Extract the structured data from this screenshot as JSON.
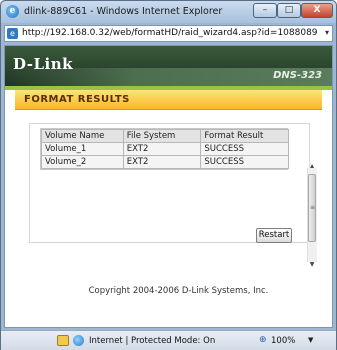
{
  "window": {
    "title": "dlink-889C61 - Windows Internet Explorer",
    "minimize_label": "–",
    "maximize_label": "□",
    "close_label": "X"
  },
  "address": {
    "url": "http://192.168.0.32/web/formatHD/raid_wizard4.asp?id=1088089"
  },
  "header": {
    "brand": "D-Link",
    "model": "DNS-323"
  },
  "section": {
    "title": "FORMAT RESULTS"
  },
  "results": {
    "columns": [
      "Volume Name",
      "File System",
      "Format Result"
    ],
    "rows": [
      [
        "Volume_1",
        "EXT2",
        "SUCCESS"
      ],
      [
        "Volume_2",
        "EXT2",
        "SUCCESS"
      ]
    ],
    "restart_label": "Restart"
  },
  "footer": {
    "copyright": "Copyright 2004-2006 D-Link Systems, Inc."
  },
  "statusbar": {
    "zone_text": "Internet | Protected Mode: On",
    "zoom": "100%"
  },
  "icons": {
    "ie_logo": "ie-logo-icon",
    "page": "page-icon",
    "shield": "shield-icon",
    "globe": "globe-icon",
    "zoom": "zoom-icon"
  }
}
